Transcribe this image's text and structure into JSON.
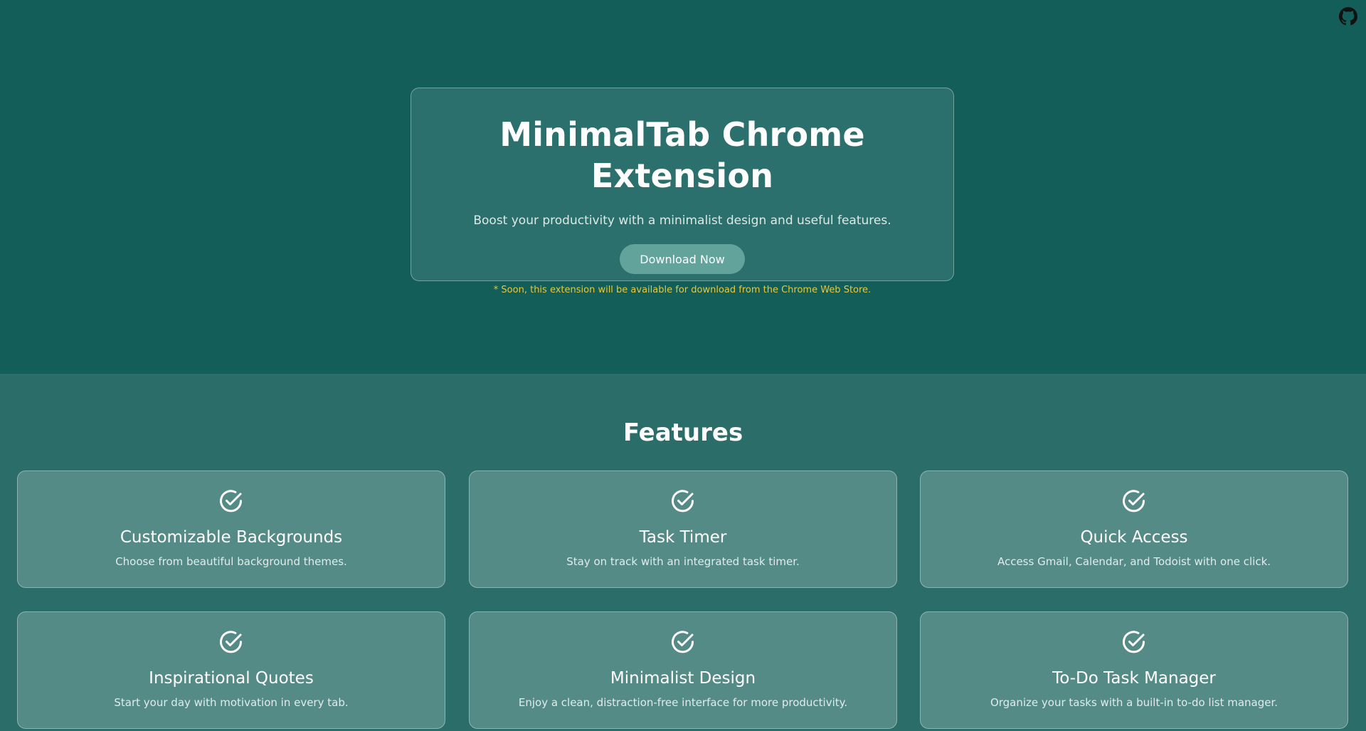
{
  "header": {
    "github_icon": "github-icon"
  },
  "hero": {
    "title": "MinimalTab Chrome Extension",
    "subtitle": "Boost your productivity with a minimalist design and useful features.",
    "download_label": "Download Now",
    "note": "* Soon, this extension will be available for download from the Chrome Web Store."
  },
  "features": {
    "title": "Features",
    "icon": "check-circle-icon",
    "items": [
      {
        "title": "Customizable Backgrounds",
        "description": "Choose from beautiful background themes."
      },
      {
        "title": "Task Timer",
        "description": "Stay on track with an integrated task timer."
      },
      {
        "title": "Quick Access",
        "description": "Access Gmail, Calendar, and Todoist with one click."
      },
      {
        "title": "Inspirational Quotes",
        "description": "Start your day with motivation in every tab."
      },
      {
        "title": "Minimalist Design",
        "description": "Enjoy a clean, distraction-free interface for more productivity."
      },
      {
        "title": "To-Do Task Manager",
        "description": "Organize your tasks with a built-in to-do list manager."
      }
    ]
  },
  "colors": {
    "hero_bg": "#135e59",
    "features_bg": "#2a6d69",
    "card_bg": "#548b87",
    "button_bg": "#62a39c",
    "note": "#e6c83a"
  }
}
